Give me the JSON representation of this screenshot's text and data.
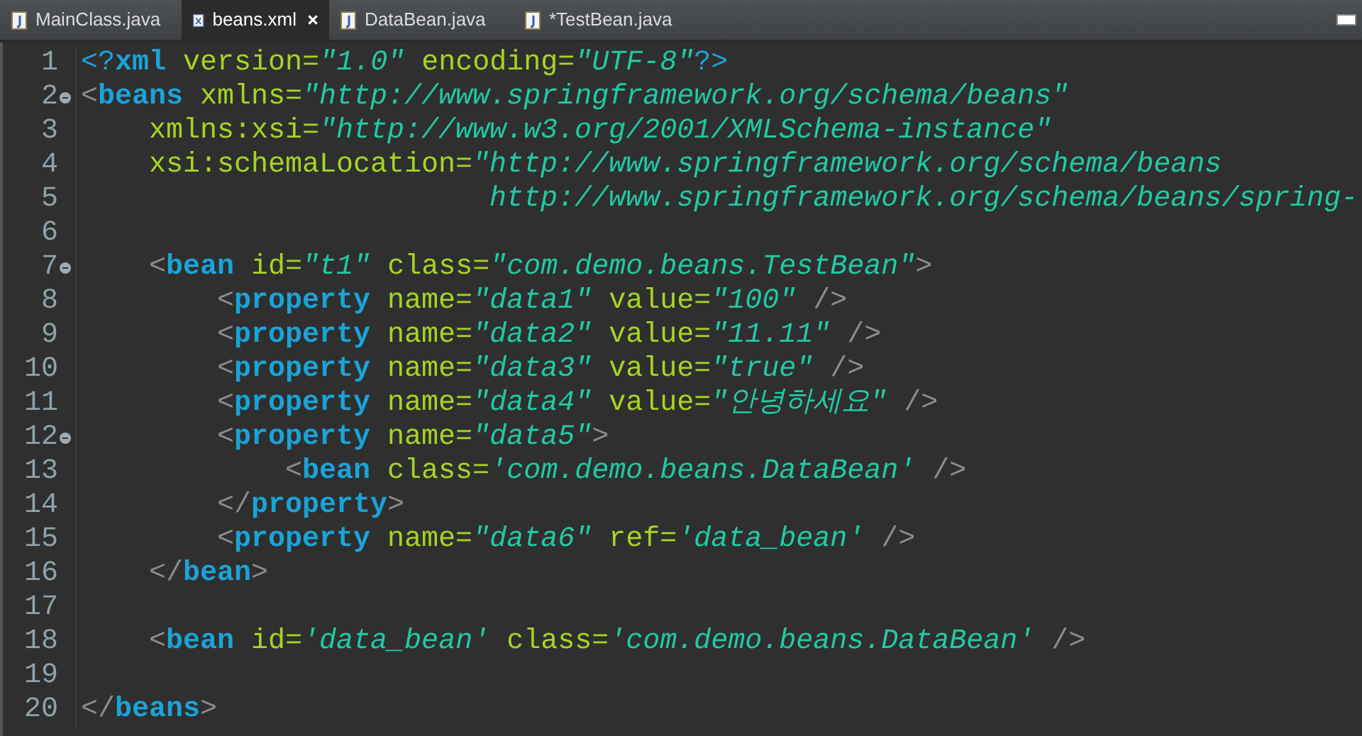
{
  "tabs": [
    {
      "label": "MainClass.java",
      "kind": "java",
      "selected": false
    },
    {
      "label": "beans.xml",
      "kind": "xml",
      "selected": true
    },
    {
      "label": "DataBean.java",
      "kind": "java",
      "selected": false
    },
    {
      "label": "*TestBean.java",
      "kind": "java",
      "selected": false
    }
  ],
  "editor": {
    "lines": [
      {
        "number": "1",
        "fold_marker": false,
        "tokens": [
          {
            "kind": "decl",
            "text": "<?"
          },
          {
            "kind": "tag",
            "text": "xml"
          },
          {
            "kind": "attr",
            "text": " version="
          },
          {
            "kind": "value",
            "text": "\"1.0\""
          },
          {
            "kind": "attr",
            "text": " encoding="
          },
          {
            "kind": "value",
            "text": "\"UTF-8\""
          },
          {
            "kind": "decl",
            "text": "?>"
          }
        ]
      },
      {
        "number": "2",
        "fold_marker": true,
        "tokens": [
          {
            "kind": "punct",
            "text": "<"
          },
          {
            "kind": "tag",
            "text": "beans"
          },
          {
            "kind": "attr",
            "text": " xmlns="
          },
          {
            "kind": "value",
            "text": "\"http://www.springframework.org/schema/beans\""
          }
        ]
      },
      {
        "number": "3",
        "fold_marker": false,
        "tokens": [
          {
            "kind": "attr",
            "text": "    xmlns:xsi="
          },
          {
            "kind": "value",
            "text": "\"http://www.w3.org/2001/XMLSchema-instance\""
          }
        ]
      },
      {
        "number": "4",
        "fold_marker": false,
        "tokens": [
          {
            "kind": "attr",
            "text": "    xsi:schemaLocation="
          },
          {
            "kind": "value",
            "text": "\"http://www.springframework.org/schema/beans"
          }
        ]
      },
      {
        "number": "5",
        "fold_marker": false,
        "tokens": [
          {
            "kind": "value",
            "text": "                        http://www.springframework.org/schema/beans/spring-"
          }
        ]
      },
      {
        "number": "6",
        "fold_marker": false
      },
      {
        "number": "7",
        "fold_marker": true,
        "tokens": [
          {
            "kind": "punct",
            "text": "    <"
          },
          {
            "kind": "tag",
            "text": "bean"
          },
          {
            "kind": "attr",
            "text": " id="
          },
          {
            "kind": "value",
            "text": "\"t1\""
          },
          {
            "kind": "attr",
            "text": " class="
          },
          {
            "kind": "value",
            "text": "\"com.demo.beans.TestBean\""
          },
          {
            "kind": "punct",
            "text": ">"
          }
        ]
      },
      {
        "number": "8",
        "fold_marker": false,
        "tokens": [
          {
            "kind": "punct",
            "text": "        <"
          },
          {
            "kind": "tag",
            "text": "property"
          },
          {
            "kind": "attr",
            "text": " name="
          },
          {
            "kind": "value",
            "text": "\"data1\""
          },
          {
            "kind": "attr",
            "text": " value="
          },
          {
            "kind": "value",
            "text": "\"100\""
          },
          {
            "kind": "punct",
            "text": " />"
          }
        ]
      },
      {
        "number": "9",
        "fold_marker": false,
        "tokens": [
          {
            "kind": "punct",
            "text": "        <"
          },
          {
            "kind": "tag",
            "text": "property"
          },
          {
            "kind": "attr",
            "text": " name="
          },
          {
            "kind": "value",
            "text": "\"data2\""
          },
          {
            "kind": "attr",
            "text": " value="
          },
          {
            "kind": "value",
            "text": "\"11.11\""
          },
          {
            "kind": "punct",
            "text": " />"
          }
        ]
      },
      {
        "number": "10",
        "fold_marker": false,
        "tokens": [
          {
            "kind": "punct",
            "text": "        <"
          },
          {
            "kind": "tag",
            "text": "property"
          },
          {
            "kind": "attr",
            "text": " name="
          },
          {
            "kind": "value",
            "text": "\"data3\""
          },
          {
            "kind": "attr",
            "text": " value="
          },
          {
            "kind": "value",
            "text": "\"true\""
          },
          {
            "kind": "punct",
            "text": " />"
          }
        ]
      },
      {
        "number": "11",
        "fold_marker": false,
        "tokens": [
          {
            "kind": "punct",
            "text": "        <"
          },
          {
            "kind": "tag",
            "text": "property"
          },
          {
            "kind": "attr",
            "text": " name="
          },
          {
            "kind": "value",
            "text": "\"data4\""
          },
          {
            "kind": "attr",
            "text": " value="
          },
          {
            "kind": "value",
            "text": "\"안녕하세요\""
          },
          {
            "kind": "punct",
            "text": " />"
          }
        ]
      },
      {
        "number": "12",
        "fold_marker": true,
        "tokens": [
          {
            "kind": "punct",
            "text": "        <"
          },
          {
            "kind": "tag",
            "text": "property"
          },
          {
            "kind": "attr",
            "text": " name="
          },
          {
            "kind": "value",
            "text": "\"data5\""
          },
          {
            "kind": "punct",
            "text": ">"
          }
        ]
      },
      {
        "number": "13",
        "fold_marker": false,
        "tokens": [
          {
            "kind": "punct",
            "text": "            <"
          },
          {
            "kind": "tag",
            "text": "bean"
          },
          {
            "kind": "attr",
            "text": " class="
          },
          {
            "kind": "value",
            "text": "'com.demo.beans.DataBean'"
          },
          {
            "kind": "punct",
            "text": " />"
          }
        ]
      },
      {
        "number": "14",
        "fold_marker": false,
        "tokens": [
          {
            "kind": "punct",
            "text": "        </"
          },
          {
            "kind": "tag",
            "text": "property"
          },
          {
            "kind": "punct",
            "text": ">"
          }
        ]
      },
      {
        "number": "15",
        "fold_marker": false,
        "tokens": [
          {
            "kind": "punct",
            "text": "        <"
          },
          {
            "kind": "tag",
            "text": "property"
          },
          {
            "kind": "attr",
            "text": " name="
          },
          {
            "kind": "value",
            "text": "\"data6\""
          },
          {
            "kind": "attr",
            "text": " ref="
          },
          {
            "kind": "value",
            "text": "'data_bean'"
          },
          {
            "kind": "punct",
            "text": " />"
          }
        ]
      },
      {
        "number": "16",
        "fold_marker": false,
        "tokens": [
          {
            "kind": "punct",
            "text": "    </"
          },
          {
            "kind": "tag",
            "text": "bean"
          },
          {
            "kind": "punct",
            "text": ">"
          }
        ]
      },
      {
        "number": "17",
        "fold_marker": false
      },
      {
        "number": "18",
        "fold_marker": false,
        "tokens": [
          {
            "kind": "punct",
            "text": "    <"
          },
          {
            "kind": "tag",
            "text": "bean"
          },
          {
            "kind": "attr",
            "text": " id="
          },
          {
            "kind": "value",
            "text": "'data_bean'"
          },
          {
            "kind": "attr",
            "text": " class="
          },
          {
            "kind": "value",
            "text": "'com.demo.beans.DataBean'"
          },
          {
            "kind": "punct",
            "text": " />"
          }
        ]
      },
      {
        "number": "19",
        "fold_marker": false
      },
      {
        "number": "20",
        "fold_marker": false,
        "tokens": [
          {
            "kind": "punct",
            "text": "</"
          },
          {
            "kind": "tag",
            "text": "beans"
          },
          {
            "kind": "punct",
            "text": ">"
          }
        ]
      }
    ]
  }
}
